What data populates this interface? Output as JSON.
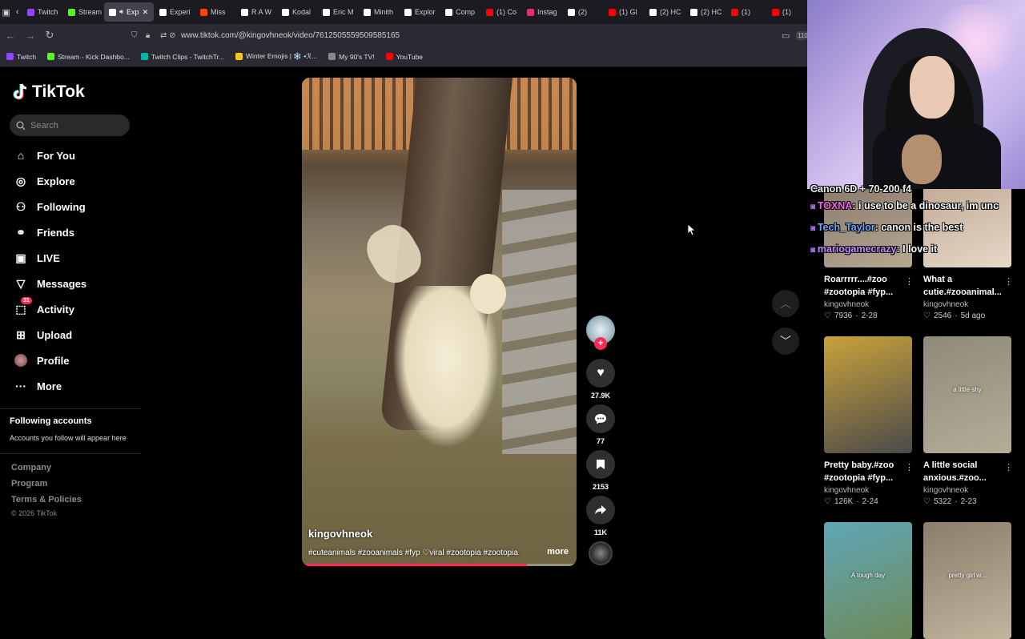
{
  "browser": {
    "tabs": [
      {
        "label": "Twitch",
        "color": "#9146ff"
      },
      {
        "label": "Stream",
        "color": "#53fc18"
      },
      {
        "label": "Exp",
        "color": "#ffffff",
        "active": true
      },
      {
        "label": "Experi",
        "color": "#ffffff"
      },
      {
        "label": "Miss",
        "color": "#ff4500"
      },
      {
        "label": "R A W",
        "color": "#ffffff"
      },
      {
        "label": "Kodal",
        "color": "#ffffff"
      },
      {
        "label": "Eric M",
        "color": "#ffffff"
      },
      {
        "label": "Minith",
        "color": "#ffffff"
      },
      {
        "label": "Explor",
        "color": "#ffffff"
      },
      {
        "label": "Comp",
        "color": "#ffffff"
      },
      {
        "label": "(1) Co",
        "color": "#ff0000"
      },
      {
        "label": "Instag",
        "color": "#e1306c"
      },
      {
        "label": "(2)",
        "color": "#ffffff"
      },
      {
        "label": "(1) Gl",
        "color": "#ff0000"
      },
      {
        "label": "(2) HC",
        "color": "#ffffff"
      },
      {
        "label": "(2) HC",
        "color": "#ffffff"
      },
      {
        "label": "(1)",
        "color": "#ff0000"
      },
      {
        "label": "(1)",
        "color": "#ff0000"
      }
    ],
    "url": "www.tiktok.com/@kingovhneok/video/7612505559509585165",
    "zoom": "110",
    "bookmarks": [
      {
        "label": "Twitch",
        "color": "#9146ff"
      },
      {
        "label": "Stream - Kick Dashbo...",
        "color": "#53fc18"
      },
      {
        "label": "Twitch Clips - TwitchTr...",
        "color": "#00b5ad"
      },
      {
        "label": "Winter Emojis | ❄️ •ℛ...",
        "color": "#f5c518"
      },
      {
        "label": "My 90's TV!",
        "color": "#888888"
      },
      {
        "label": "YouTube",
        "color": "#ff0000"
      }
    ]
  },
  "tiktok": {
    "logo_text": "TikTok",
    "search_placeholder": "Search",
    "nav": [
      {
        "label": "For You",
        "icon": "home-icon"
      },
      {
        "label": "Explore",
        "icon": "compass-icon"
      },
      {
        "label": "Following",
        "icon": "following-icon"
      },
      {
        "label": "Friends",
        "icon": "friends-icon"
      },
      {
        "label": "LIVE",
        "icon": "live-icon"
      },
      {
        "label": "Messages",
        "icon": "messages-icon"
      },
      {
        "label": "Activity",
        "icon": "activity-icon",
        "badge": "31"
      },
      {
        "label": "Upload",
        "icon": "upload-icon"
      },
      {
        "label": "Profile",
        "icon": "avatar"
      },
      {
        "label": "More",
        "icon": "more-icon"
      }
    ],
    "following_title": "Following accounts",
    "following_empty": "Accounts you follow will appear here",
    "footer": [
      "Company",
      "Program",
      "Terms & Policies"
    ],
    "copyright": "© 2026 TikTok"
  },
  "video": {
    "username": "kingovhneok",
    "caption": "#cuteanimals #zooanimals #fyp ♡viral #zootopia #zootopia",
    "more_label": "more",
    "progress_percent": 82,
    "likes": "27.9K",
    "comments": "77",
    "saves": "2153",
    "shares": "11K"
  },
  "related": [
    {
      "title": "Roarrrrr....#zoo #zootopia #fyp...",
      "author": "kingovhneok",
      "likes": "7936",
      "date": "2-28",
      "colors": [
        "#7a6c60",
        "#b7a893"
      ],
      "thumb_text": ""
    },
    {
      "title": "What a cutie.#zooanimal...",
      "author": "kingovhneok",
      "likes": "2546",
      "date": "5d ago",
      "colors": [
        "#b79c86",
        "#e7d8c8"
      ],
      "thumb_text": ""
    },
    {
      "title": "Pretty baby.#zoo #zootopia #fyp...",
      "author": "kingovhneok",
      "likes": "126K",
      "date": "2-24",
      "colors": [
        "#c9a23a",
        "#4a4a4a"
      ],
      "thumb_text": ""
    },
    {
      "title": "A little social anxious.#zoo...",
      "author": "kingovhneok",
      "likes": "5322",
      "date": "2-23",
      "colors": [
        "#8f8a79",
        "#b3ad98"
      ],
      "thumb_text": "a little shy"
    },
    {
      "title": "",
      "author": "",
      "likes": "",
      "date": "",
      "colors": [
        "#5fa6b6",
        "#6e8a5a"
      ],
      "thumb_text": "A tough day"
    },
    {
      "title": "",
      "author": "",
      "likes": "",
      "date": "",
      "colors": [
        "#8b7e6a",
        "#c2b59e"
      ],
      "thumb_text": "pretty girl w..."
    }
  ],
  "stream": {
    "camera_caption": "Canon 6D + 70-200 f4",
    "chat": [
      {
        "user": "TOXNA",
        "color": "#ff5cf0",
        "message": "i use to be a dinosaur, im unc"
      },
      {
        "user": "Tech_Taylor",
        "color": "#6fa8ff",
        "message": "canon is the best"
      },
      {
        "user": "mariogamecrazy",
        "color": "#c48cff",
        "message": "I love it"
      }
    ]
  }
}
